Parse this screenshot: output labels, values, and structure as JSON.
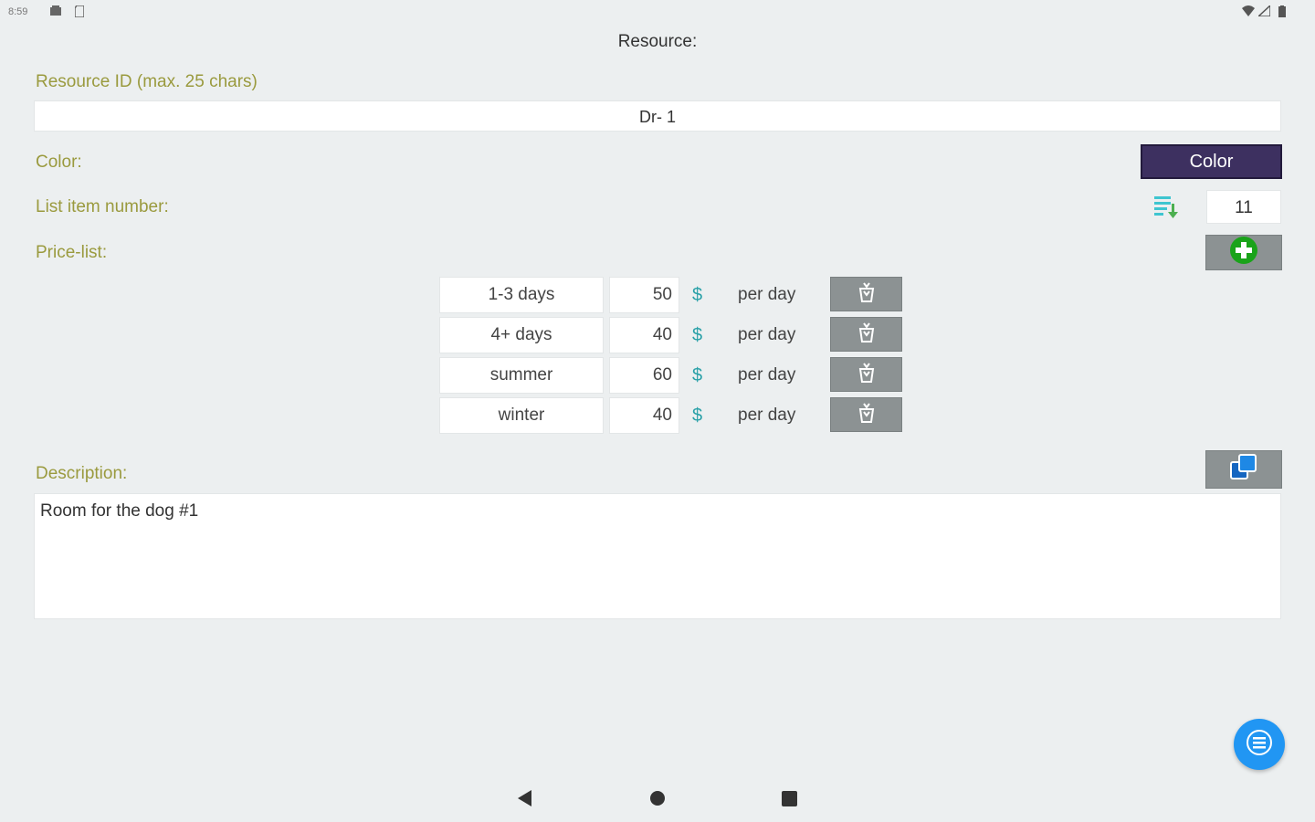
{
  "status_bar": {
    "time": "8:59",
    "icons": [
      "notification-icon",
      "sd-card-icon",
      "wifi-icon",
      "signal-icon",
      "battery-icon"
    ]
  },
  "header": {
    "title": "Resource:"
  },
  "resource_id": {
    "label": "Resource ID (max. 25 chars)",
    "value": "Dr- 1"
  },
  "color": {
    "label": "Color:",
    "button_label": "Color",
    "swatch": "#3d3060"
  },
  "list_item": {
    "label": "List item number:",
    "value": "11"
  },
  "price_list": {
    "label": "Price-list:",
    "rows": [
      {
        "period": "1-3 days",
        "price": "50",
        "currency": "$",
        "unit": "per day"
      },
      {
        "period": "4+ days",
        "price": "40",
        "currency": "$",
        "unit": "per day"
      },
      {
        "period": "summer",
        "price": "60",
        "currency": "$",
        "unit": "per day"
      },
      {
        "period": "winter",
        "price": "40",
        "currency": "$",
        "unit": "per day"
      }
    ]
  },
  "description": {
    "label": "Description:",
    "value": "Room for the dog #1"
  },
  "colors": {
    "label_text": "#9a9a3e",
    "accent": "#2196f3",
    "add_green": "#1aa31a",
    "button_gray": "#8c9293"
  }
}
